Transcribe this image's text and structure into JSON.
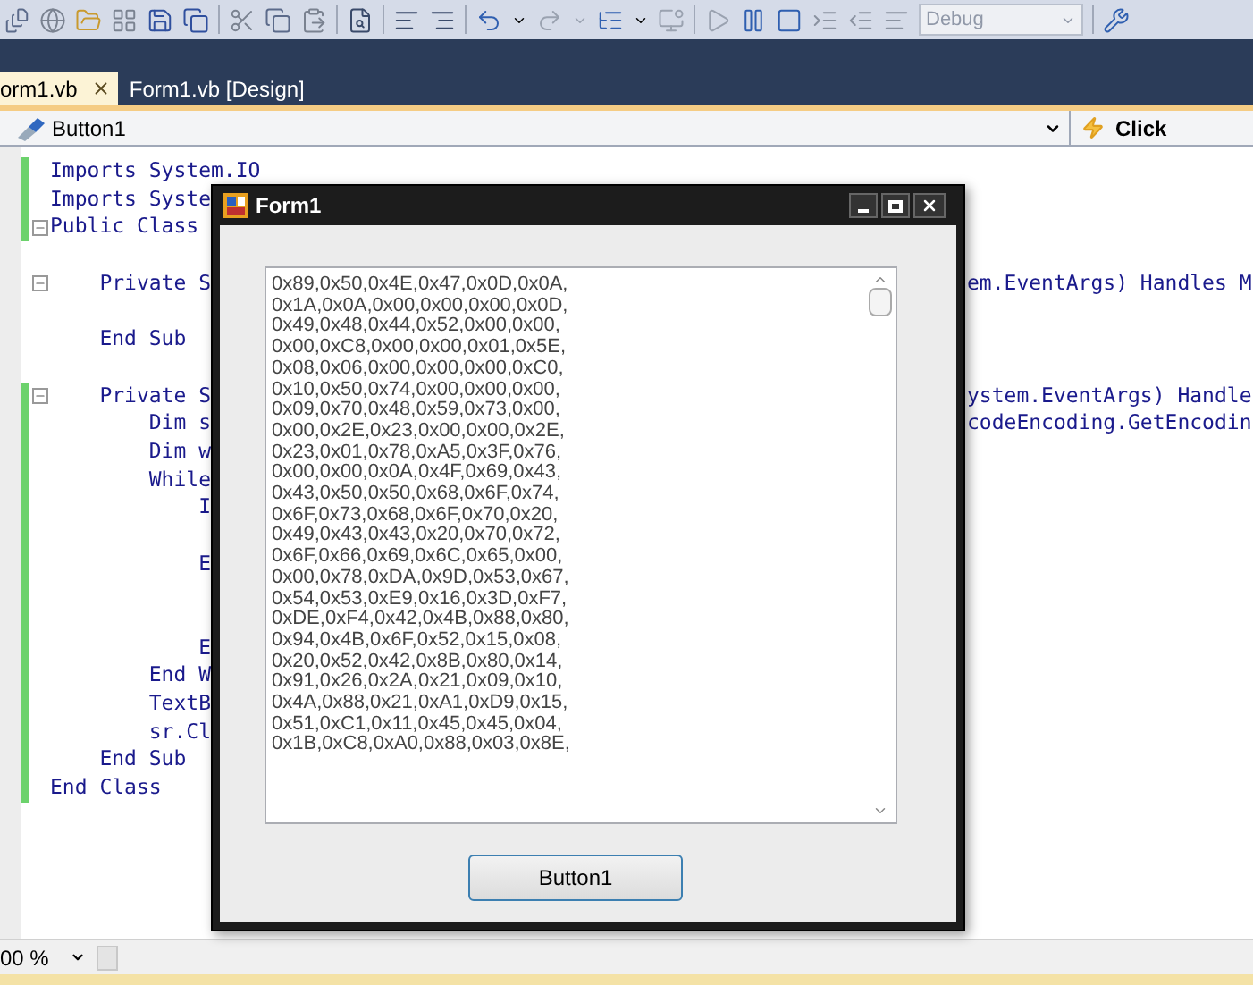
{
  "toolbar": {
    "configuration": "Debug"
  },
  "tabs": [
    {
      "label": "orm1.vb",
      "selected": true,
      "closable": true
    },
    {
      "label": "Form1.vb [Design]",
      "selected": false,
      "closable": false
    }
  ],
  "navigation": {
    "object": "Button1",
    "event": "Click"
  },
  "code_lines": [
    {
      "left": "Imports System.IO",
      "fold": false,
      "changed": true
    },
    {
      "left": "Imports Syste",
      "fold": false,
      "changed": true
    },
    {
      "left": "Public Class",
      "fold": true,
      "changed": true
    },
    {
      "fold": false,
      "changed": false
    },
    {
      "left": "    Private S",
      "right": "em.EventArgs) Handles M",
      "fold": true,
      "changed": false
    },
    {
      "fold": false,
      "changed": false
    },
    {
      "left": "    End Sub",
      "fold": false,
      "changed": false
    },
    {
      "fold": false,
      "changed": false
    },
    {
      "left": "    Private S",
      "right": "ystem.EventArgs) Handle",
      "fold": true,
      "changed": true
    },
    {
      "left": "        Dim s",
      "right": "codeEncoding.GetEncodin",
      "fold": false,
      "changed": true
    },
    {
      "left": "        Dim w",
      "fold": false,
      "changed": true
    },
    {
      "left": "        While",
      "fold": false,
      "changed": true
    },
    {
      "left": "            I",
      "fold": false,
      "changed": true
    },
    {
      "fold": false,
      "changed": true
    },
    {
      "left": "            E",
      "fold": false,
      "changed": true
    },
    {
      "fold": false,
      "changed": true
    },
    {
      "fold": false,
      "changed": true
    },
    {
      "left": "            E",
      "fold": false,
      "changed": true
    },
    {
      "left": "        End W",
      "fold": false,
      "changed": true
    },
    {
      "left": "        TextB",
      "fold": false,
      "changed": true
    },
    {
      "left": "        sr.Cl",
      "fold": false,
      "changed": true
    },
    {
      "left": "    End Sub",
      "fold": false,
      "changed": true
    },
    {
      "left": "End Class",
      "fold": false,
      "changed": true
    }
  ],
  "zoom": "00 %",
  "form": {
    "title": "Form1",
    "button": "Button1",
    "textbox_lines": [
      "0x89,0x50,0x4E,0x47,0x0D,0x0A,",
      "0x1A,0x0A,0x00,0x00,0x00,0x0D,",
      "0x49,0x48,0x44,0x52,0x00,0x00,",
      "0x00,0xC8,0x00,0x00,0x01,0x5E,",
      "0x08,0x06,0x00,0x00,0x00,0xC0,",
      "0x10,0x50,0x74,0x00,0x00,0x00,",
      "0x09,0x70,0x48,0x59,0x73,0x00,",
      "0x00,0x2E,0x23,0x00,0x00,0x2E,",
      "0x23,0x01,0x78,0xA5,0x3F,0x76,",
      "0x00,0x00,0x0A,0x4F,0x69,0x43,",
      "0x43,0x50,0x50,0x68,0x6F,0x74,",
      "0x6F,0x73,0x68,0x6F,0x70,0x20,",
      "0x49,0x43,0x43,0x20,0x70,0x72,",
      "0x6F,0x66,0x69,0x6C,0x65,0x00,",
      "0x00,0x78,0xDA,0x9D,0x53,0x67,",
      "0x54,0x53,0xE9,0x16,0x3D,0xF7,",
      "0xDE,0xF4,0x42,0x4B,0x88,0x80,",
      "0x94,0x4B,0x6F,0x52,0x15,0x08,",
      "0x20,0x52,0x42,0x8B,0x80,0x14,",
      "0x91,0x26,0x2A,0x21,0x09,0x10,",
      "0x4A,0x88,0x21,0xA1,0xD9,0x15,",
      "0x51,0xC1,0x11,0x45,0x45,0x04,",
      "0x1B,0xC8,0xA0,0x88,0x03,0x8E,"
    ]
  }
}
